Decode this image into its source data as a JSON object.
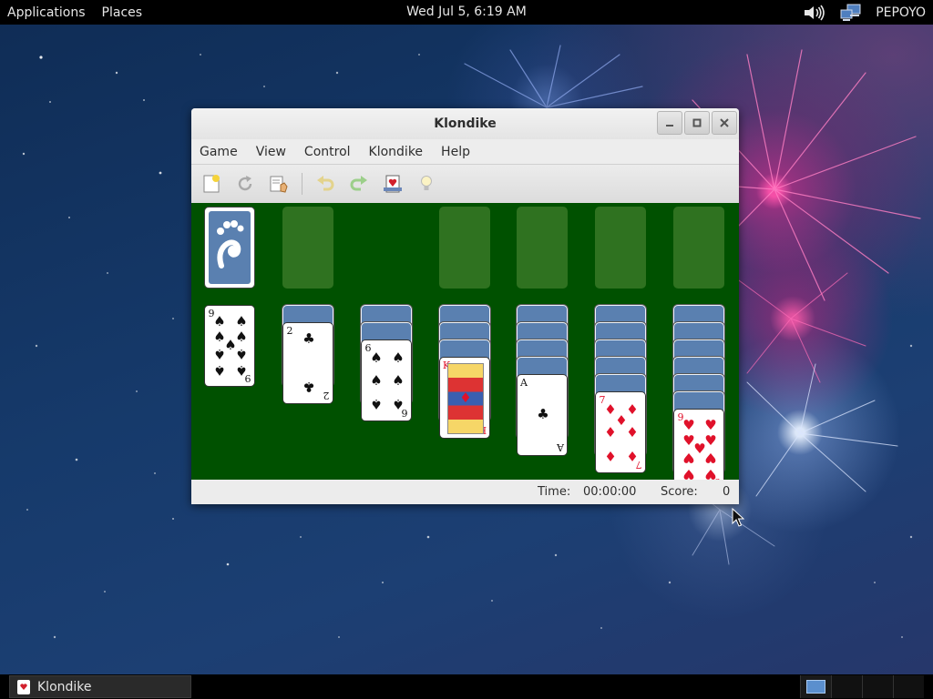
{
  "top_panel": {
    "applications": "Applications",
    "places": "Places",
    "clock": "Wed Jul  5,  6:19 AM",
    "user": "PEPOYO"
  },
  "window": {
    "title": "Klondike",
    "menu": [
      "Game",
      "View",
      "Control",
      "Klondike",
      "Help"
    ],
    "toolbar_icons": [
      "new-game-icon",
      "restart-icon",
      "select-game-icon",
      "undo-icon",
      "redo-icon",
      "deal-icon",
      "hint-icon"
    ],
    "status": {
      "time_label": "Time:",
      "time_value": "00:00:00",
      "score_label": "Score:",
      "score_value": "0"
    }
  },
  "game": {
    "foundations": 4,
    "tableau": [
      {
        "face_down": 0,
        "top_card": {
          "rank": "9",
          "suit": "♠",
          "color": "black"
        }
      },
      {
        "face_down": 1,
        "top_card": {
          "rank": "2",
          "suit": "♣",
          "color": "black"
        }
      },
      {
        "face_down": 2,
        "top_card": {
          "rank": "6",
          "suit": "♠",
          "color": "black"
        }
      },
      {
        "face_down": 3,
        "top_card": {
          "rank": "K",
          "suit": "♦",
          "color": "red"
        }
      },
      {
        "face_down": 4,
        "top_card": {
          "rank": "A",
          "suit": "♣",
          "color": "black"
        }
      },
      {
        "face_down": 5,
        "top_card": {
          "rank": "7",
          "suit": "♦",
          "color": "red"
        }
      },
      {
        "face_down": 6,
        "top_card": {
          "rank": "9",
          "suit": "♥",
          "color": "red"
        }
      }
    ]
  },
  "taskbar": {
    "task_label": "Klondike"
  },
  "colors": {
    "felt": "#005100",
    "slot": "#2f7220",
    "card_back": "#5a80b0",
    "red_suit": "#e0112a"
  }
}
